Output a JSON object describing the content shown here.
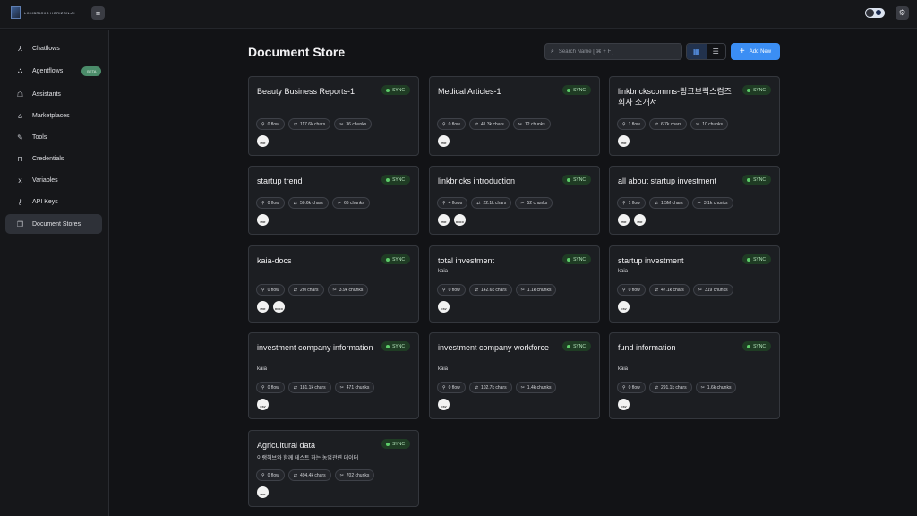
{
  "app": {
    "logo_text": "LINKBRICKS HORIZON-AI",
    "logo_sub": ""
  },
  "page": {
    "title": "Document Store"
  },
  "search": {
    "placeholder": "Search Name [ ⌘ + F ]"
  },
  "toolbar": {
    "add_label": "Add New"
  },
  "sidebar": {
    "items": [
      {
        "label": "Chatflows",
        "icon": "chatflows-icon"
      },
      {
        "label": "Agentflows",
        "icon": "agentflows-icon",
        "badge": "BETA"
      },
      {
        "label": "Assistants",
        "icon": "assistants-icon"
      },
      {
        "label": "Marketplaces",
        "icon": "marketplace-icon"
      },
      {
        "label": "Tools",
        "icon": "tools-icon"
      },
      {
        "label": "Credentials",
        "icon": "lock-icon"
      },
      {
        "label": "Variables",
        "icon": "variables-icon"
      },
      {
        "label": "API Keys",
        "icon": "key-icon"
      },
      {
        "label": "Document Stores",
        "icon": "document-stores-icon",
        "active": true
      }
    ]
  },
  "colors": {
    "accent": "#3b8ef4",
    "sync_bg": "#1f3c24",
    "sync_dot": "#5ecc6a",
    "beta_bg": "#4b8c6a"
  },
  "cards": [
    {
      "title": "Beauty Business Reports-1",
      "status": "SYNC",
      "description": "",
      "flows": "0 flow",
      "chars": "117.6k chars",
      "chunks": "36 chunks",
      "files": [
        "PDF"
      ]
    },
    {
      "title": "Medical Articles-1",
      "status": "SYNC",
      "description": "",
      "flows": "0 flow",
      "chars": "41.3k chars",
      "chunks": "12 chunks",
      "files": [
        "PDF"
      ]
    },
    {
      "title": "linkbrickscomms-링크브릭스컴즈 회사 소개서",
      "status": "SYNC",
      "description": "",
      "flows": "1 flow",
      "chars": "6.7k chars",
      "chunks": "10 chunks",
      "files": [
        "PDF"
      ]
    },
    {
      "title": "startup trend",
      "status": "SYNC",
      "description": "",
      "flows": "0 flow",
      "chars": "50.6k chars",
      "chunks": "66 chunks",
      "files": [
        "PDF"
      ]
    },
    {
      "title": "linkbricks introduction",
      "status": "SYNC",
      "description": "",
      "flows": "4 flows",
      "chars": "22.1k chars",
      "chunks": "52 chunks",
      "files": [
        "PDF",
        "DOCX"
      ]
    },
    {
      "title": "all about startup investment",
      "status": "SYNC",
      "description": "",
      "flows": "1 flow",
      "chars": "1.5M chars",
      "chunks": "3.1k chunks",
      "files": [
        "PDF",
        "PDF"
      ]
    },
    {
      "title": "kaia-docs",
      "status": "SYNC",
      "description": "",
      "flows": "0 flow",
      "chars": "2M chars",
      "chunks": "3.9k chunks",
      "files": [
        "PDF",
        "DOCX"
      ]
    },
    {
      "title": "total investment",
      "status": "SYNC",
      "description": "kaia",
      "flows": "0 flow",
      "chars": "142.6k chars",
      "chunks": "1.1k chunks",
      "files": [
        "CSV"
      ]
    },
    {
      "title": "startup investment",
      "status": "SYNC",
      "description": "kaia",
      "flows": "0 flow",
      "chars": "47.1k chars",
      "chunks": "319 chunks",
      "files": [
        "CSV"
      ]
    },
    {
      "title": "investment company information",
      "status": "SYNC",
      "description": "kaia",
      "flows": "0 flow",
      "chars": "181.1k chars",
      "chunks": "471 chunks",
      "files": [
        "CSV"
      ]
    },
    {
      "title": "investment company workforce",
      "status": "SYNC",
      "description": "kaia",
      "flows": "0 flow",
      "chars": "102.7k chars",
      "chunks": "1.4k chunks",
      "files": [
        "CSV"
      ]
    },
    {
      "title": "fund information",
      "status": "SYNC",
      "description": "kaia",
      "flows": "0 flow",
      "chars": "291.1k chars",
      "chunks": "1.6k chunks",
      "files": [
        "CSV"
      ]
    },
    {
      "title": "Agricultural data",
      "status": "SYNC",
      "description": "이랭허브와 함께 테스트 하는 농업관련 데이터",
      "flows": "0 flow",
      "chars": "494.4k chars",
      "chunks": "702 chunks",
      "files": [
        "PDF"
      ]
    }
  ]
}
